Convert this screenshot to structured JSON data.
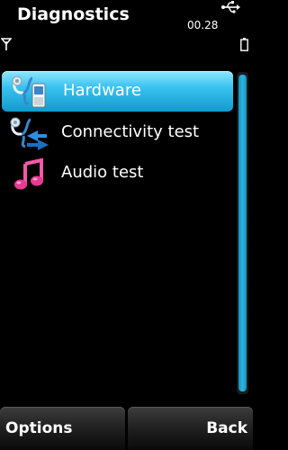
{
  "header": {
    "title": "Diagnostics",
    "clock": "00.28",
    "usb_icon": "usb-icon",
    "signal_icon": "signal-antenna-icon",
    "battery_icon": "battery-icon"
  },
  "list": {
    "items": [
      {
        "label": "Hardware",
        "icon": "stethoscope-phone-icon",
        "selected": true
      },
      {
        "label": "Connectivity test",
        "icon": "stethoscope-arrows-icon",
        "selected": false
      },
      {
        "label": "Audio test",
        "icon": "music-note-icon",
        "selected": false
      }
    ]
  },
  "softkeys": {
    "left": "Options",
    "right": "Back"
  },
  "colors": {
    "background": "#000000",
    "selection": "#39c2ef",
    "scroll_thumb": "#2fb6e4"
  }
}
